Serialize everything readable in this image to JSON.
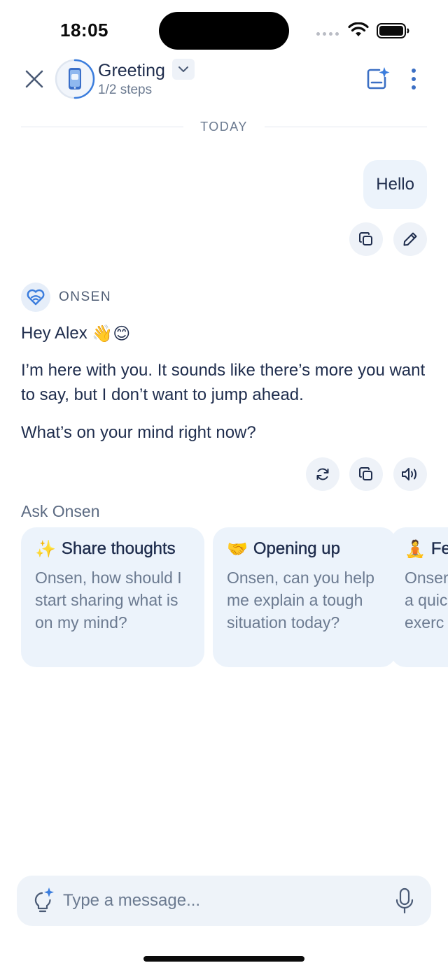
{
  "status_bar": {
    "time": "18:05"
  },
  "header": {
    "title": "Greeting",
    "subtitle": "1/2 steps",
    "progress": 0.5
  },
  "divider": {
    "label": "TODAY"
  },
  "user_message": {
    "text": "Hello"
  },
  "bot": {
    "name": "ONSEN",
    "greeting": "Hey Alex",
    "greeting_emojis": [
      "👋",
      "😊"
    ],
    "paragraph_1": "I’m here with you. It sounds like there’s more you want to say, but I don’t want to jump ahead.",
    "paragraph_2": "What’s on your mind right now?"
  },
  "ask": {
    "label": "Ask Onsen",
    "cards": [
      {
        "emoji": "✨",
        "title": "Share thoughts",
        "body": "Onsen, how should I start sharing what is on my mind?"
      },
      {
        "emoji": "🤝",
        "title": "Opening up",
        "body": "Onsen, can you help me explain a tough situation today?"
      },
      {
        "emoji": "🧘",
        "title": "Fe",
        "body": "Onser a quic exerc"
      }
    ]
  },
  "input": {
    "placeholder": "Type a message..."
  },
  "icons": {
    "close": "close-icon",
    "avatar": "phone-avatar-icon",
    "chevron": "chevron-down-icon",
    "new_chat": "note-sparkle-icon",
    "more": "more-vertical-icon",
    "copy": "copy-icon",
    "edit": "pencil-icon",
    "regenerate": "refresh-icon",
    "speak": "speaker-icon",
    "bulb": "lightbulb-sparkle-icon",
    "mic": "microphone-icon"
  },
  "colors": {
    "accent": "#3b7ddd",
    "bubble": "#ecf3fb",
    "text": "#1f2d4d",
    "muted": "#6b7a90"
  }
}
